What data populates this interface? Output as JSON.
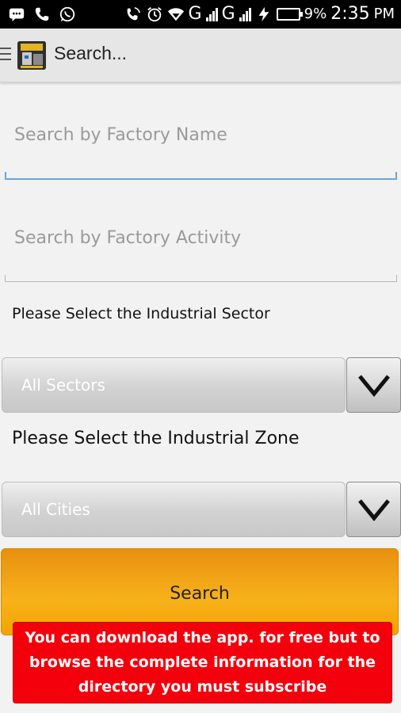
{
  "status_bar": {
    "battery_percent": "9%",
    "time": "2:35",
    "ampm": "PM",
    "network_1": "G",
    "network_2": "G"
  },
  "action_bar": {
    "title": "Search..."
  },
  "form": {
    "factory_name_placeholder": "Search by Factory Name",
    "factory_activity_placeholder": "Search by Factory Activity",
    "sector_label": "Please Select the Industrial Sector",
    "sector_value": "All Sectors",
    "zone_label": "Please Select the Industrial Zone",
    "zone_value": "All Cities",
    "search_label": "Search"
  },
  "banner": {
    "text": "You can download the app. for free but to browse the complete information for the directory you must subscribe"
  },
  "colors": {
    "search_button": "#f5a300",
    "banner_background": "#f3000c",
    "active_underline": "#6aa6d8"
  },
  "icons": [
    "message-icon",
    "phone-icon",
    "whatsapp-icon",
    "wifi-call-icon",
    "alarm-icon",
    "wifi-icon",
    "signal-icon",
    "charging-icon",
    "battery-icon",
    "menu-icon",
    "app-logo-icon",
    "chevron-down-icon"
  ]
}
